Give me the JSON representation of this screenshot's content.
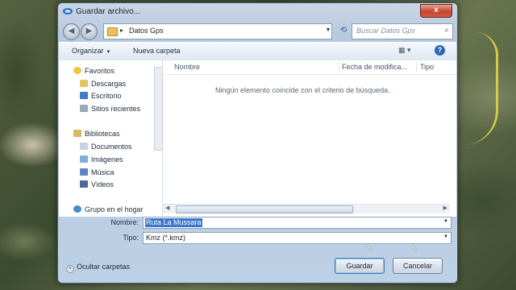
{
  "window": {
    "title": "Guardar archivo...",
    "close_glyph": "x"
  },
  "address": {
    "path": "Datos Gps",
    "separator": "▸",
    "search_placeholder": "Buscar Datos Gps"
  },
  "toolbar": {
    "organize": "Organizar",
    "new_folder": "Nueva carpeta"
  },
  "nav": {
    "favorites": "Favoritos",
    "downloads": "Descargas",
    "desktop": "Escritorio",
    "recent": "Sitios recientes",
    "libraries": "Bibliotecas",
    "documents": "Documentos",
    "images": "Imágenes",
    "music": "Música",
    "videos": "Vídeos",
    "homegroup": "Grupo en el hogar"
  },
  "columns": {
    "name": "Nombre",
    "date": "Fecha de modifica...",
    "type": "Tipo"
  },
  "empty_message": "Ningún elemento coincide con el criterio de búsqueda.",
  "form": {
    "name_label": "Nombre:",
    "name_value": "Ruta La Mussara",
    "type_label": "Tipo:",
    "type_value": "Kmz (*.kmz)"
  },
  "footer": {
    "hide_folders": "Ocultar carpetas",
    "save": "Guardar",
    "cancel": "Cancelar"
  },
  "icons": [
    "google-earth-icon",
    "back-arrow-icon",
    "forward-arrow-icon",
    "folder-icon",
    "refresh-icon",
    "search-icon",
    "view-icon",
    "help-icon",
    "star-icon",
    "download-folder-icon",
    "desktop-icon",
    "recent-places-icon",
    "library-icon",
    "documents-icon",
    "pictures-icon",
    "music-icon",
    "videos-icon",
    "homegroup-icon"
  ]
}
